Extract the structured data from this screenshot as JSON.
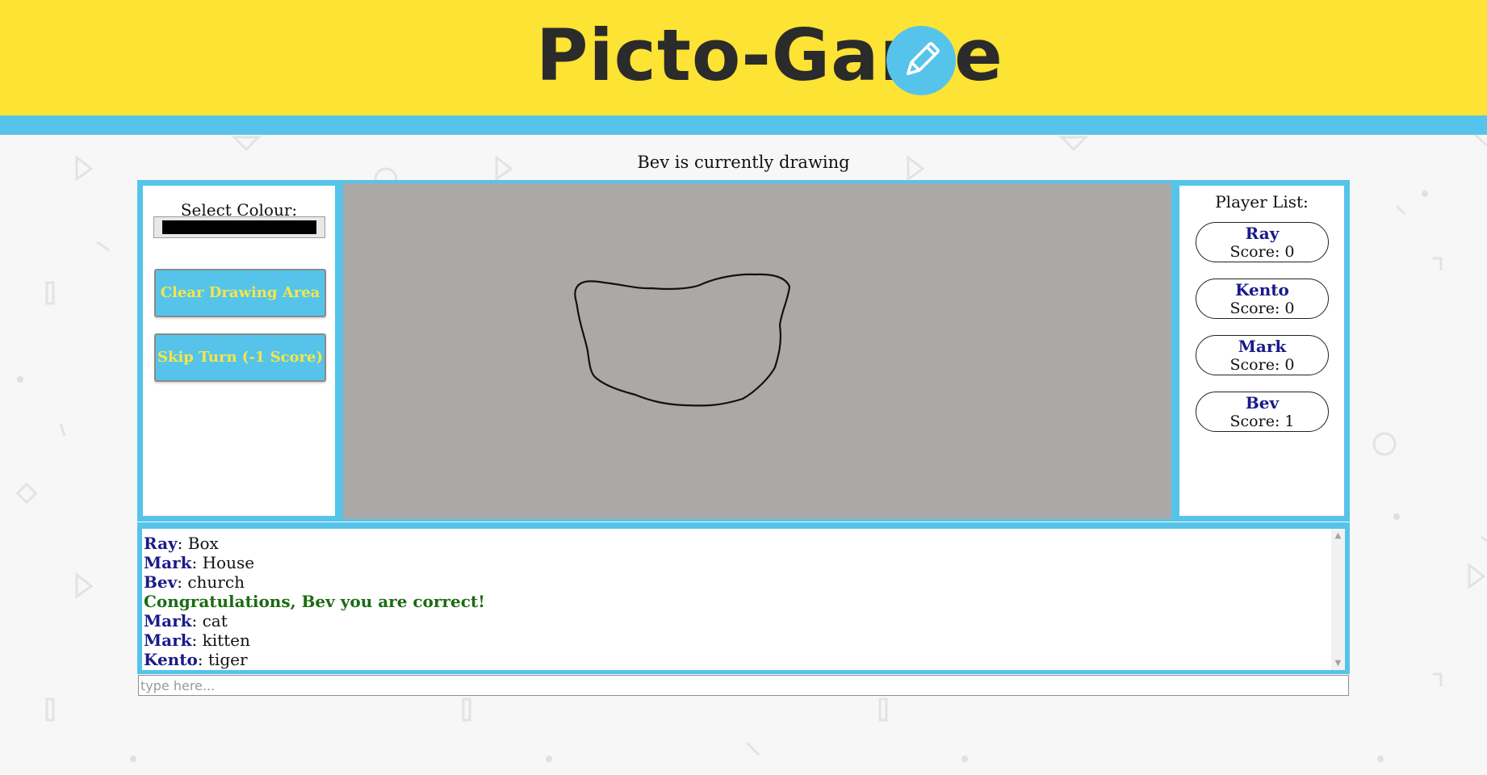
{
  "app": {
    "title": "Picto-Game",
    "logo_icon": "pencil-icon",
    "colors": {
      "header_yellow": "#fde333",
      "accent_blue": "#56c4ea",
      "canvas_gray": "#aaa9a8",
      "player_name": "#1a1a8a",
      "system_green": "#1b6b12"
    }
  },
  "status": "Bev is currently drawing",
  "tools": {
    "colour_label": "Select Colour:",
    "selected_colour": "#000000",
    "clear_label": "Clear Drawing Area",
    "skip_label": "Skip Turn (-1 Score)"
  },
  "players": {
    "title": "Player List:",
    "list": [
      {
        "name": "Ray",
        "score": "Score: 0"
      },
      {
        "name": "Kento",
        "score": "Score: 0"
      },
      {
        "name": "Mark",
        "score": "Score: 0"
      },
      {
        "name": "Bev",
        "score": "Score: 1"
      }
    ]
  },
  "chat": {
    "messages": [
      {
        "user": "Ray",
        "text": ": Box"
      },
      {
        "user": "Mark",
        "text": ": House"
      },
      {
        "user": "Bev",
        "text": ": church"
      },
      {
        "system": "Congratulations, Bev you are correct!"
      },
      {
        "user": "Mark",
        "text": ": cat"
      },
      {
        "user": "Mark",
        "text": ": kitten"
      },
      {
        "user": "Kento",
        "text": ": tiger"
      }
    ],
    "input_placeholder": "type here..."
  }
}
